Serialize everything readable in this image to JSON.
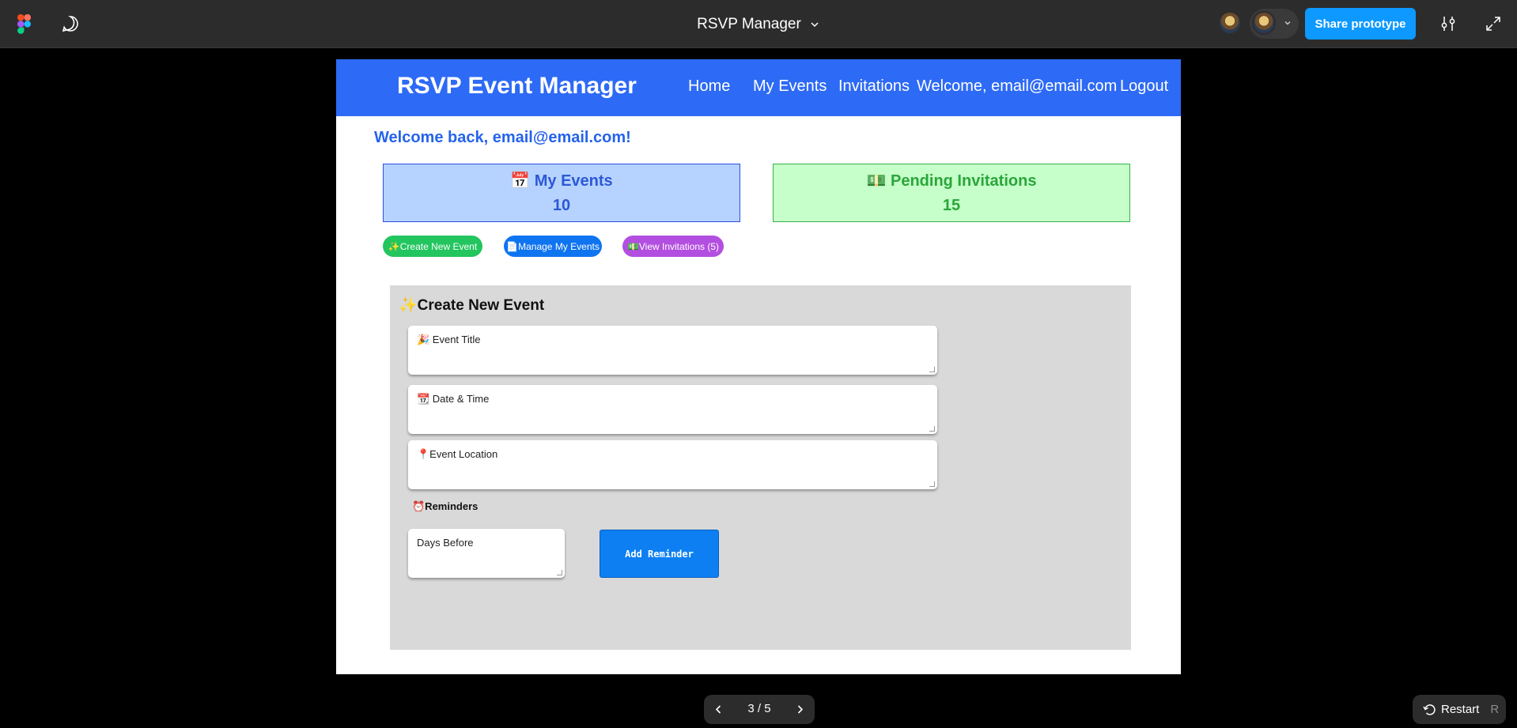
{
  "figma": {
    "doc_title": "RSVP Manager",
    "share_label": "Share prototype",
    "pager": "3 / 5",
    "restart_label": "Restart",
    "restart_key": "R"
  },
  "app": {
    "brand": "RSVP Event Manager",
    "nav": {
      "home": "Home",
      "my_events": "My Events",
      "invitations": "Invitations",
      "welcome": "Welcome, email@email.com",
      "logout": "Logout"
    },
    "welcome_back": "Welcome back, email@email.com!",
    "cards": {
      "events_title": "📅 My Events",
      "events_count": "10",
      "invites_title": "💵 Pending Invitations",
      "invites_count": "15"
    },
    "actions": {
      "create": "✨Create New Event",
      "manage": "📄Manage My Events",
      "view": "💵View Invitations (5)"
    },
    "form": {
      "title": "✨Create New Event",
      "event_title": "🎉 Event Title",
      "date_time": "📆 Date & Time",
      "location": "📍Event Location",
      "reminders": "⏰Reminders",
      "days_before": "Days Before",
      "add_reminder": "Add Reminder"
    }
  },
  "colors": {
    "figma_bar": "#2c2c2c",
    "share_blue": "#0d99ff",
    "nav_blue": "#2d6af5",
    "card_events_bg": "#b6d3ff",
    "card_invites_bg": "#c6ffca",
    "panel_bg": "#d9d9d9"
  },
  "icons": [
    "figma-logo-icon",
    "comment-icon",
    "chevron-down-icon",
    "settings-sliders-icon",
    "expand-icon",
    "chevron-left-icon",
    "chevron-right-icon",
    "restart-icon"
  ]
}
